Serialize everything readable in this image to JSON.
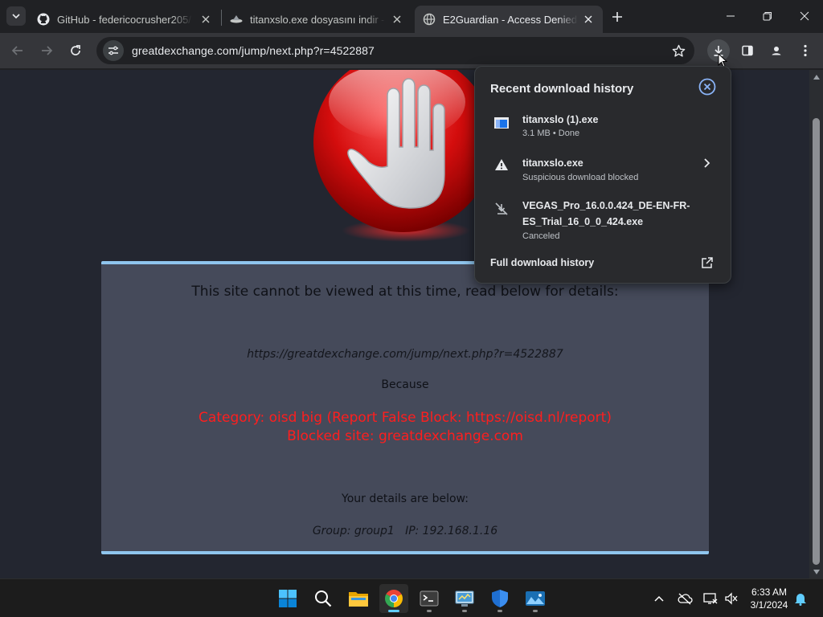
{
  "browser": {
    "tabs": [
      {
        "title": "GitHub - federicocrusher205/m",
        "icon": "github-icon",
        "active": false
      },
      {
        "title": "titanxslo.exe dosyasını indir - d",
        "icon": "site-favicon-icon",
        "active": false
      },
      {
        "title": "E2Guardian - Access Denied",
        "icon": "globe-icon",
        "active": true
      }
    ],
    "url": "greatdexchange.com/jump/next.php?r=4522887"
  },
  "page": {
    "title": "This site cannot be viewed at this time, read below for details:",
    "blocked_url": "https://greatdexchange.com/jump/next.php?r=4522887",
    "because": "Because",
    "category_line": "Category: oisd big (Report False Block: https://oisd.nl/report)",
    "blocked_site_line": "Blocked site: greatdexchange.com",
    "details_heading": "Your details are below:",
    "group_line": "Group: group1   IP: 192.168.1.16"
  },
  "downloads": {
    "title": "Recent download history",
    "items": [
      {
        "name": "titanxslo (1).exe",
        "status": "3.1 MB • Done",
        "icon": "exe-file-icon"
      },
      {
        "name": "titanxslo.exe",
        "status": "Suspicious download blocked",
        "icon": "warning-icon"
      },
      {
        "name_line1": "VEGAS_Pro_16.0.0.424_DE-EN-FR-",
        "name_line2": "ES_Trial_16_0_0_424.exe",
        "status": "Canceled",
        "icon": "canceled-download-icon"
      }
    ],
    "full_history": "Full download history"
  },
  "taskbar": {
    "time": "6:33 AM",
    "date": "3/1/2024"
  },
  "colors": {
    "accent_blue": "#8fc5ee",
    "blocked_red": "#ff1e1e",
    "message_box": "#454a5a",
    "page_bg": "#232630"
  }
}
